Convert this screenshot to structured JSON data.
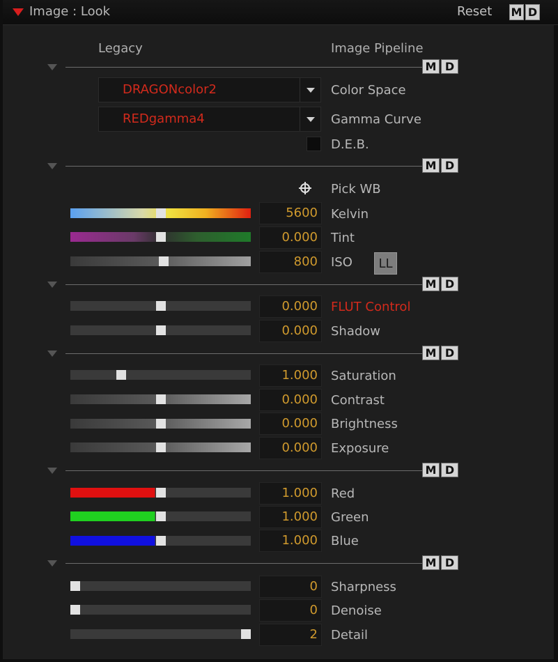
{
  "header": {
    "title": "Image : Look",
    "reset_label": "Reset",
    "m_label": "M",
    "d_label": "D"
  },
  "columns": {
    "left": "Legacy",
    "right": "Image Pipeline"
  },
  "dropdowns": [
    {
      "value": "DRAGONcolor2",
      "label": "Color Space"
    },
    {
      "value": "REDgamma4",
      "label": "Gamma Curve"
    }
  ],
  "deb": {
    "label": "D.E.B.",
    "checked": false
  },
  "pick_wb": {
    "label": "Pick WB",
    "icon": "crosshair-icon"
  },
  "ll_label": "LL",
  "sliders": {
    "kelvin": {
      "value": "5600",
      "label": "Kelvin",
      "position": 0.5
    },
    "tint": {
      "value": "0.000",
      "label": "Tint",
      "position": 0.5
    },
    "iso": {
      "value": "800",
      "label": "ISO",
      "position": 0.52
    },
    "flut": {
      "value": "0.000",
      "label": "FLUT Control",
      "position": 0.5
    },
    "shadow": {
      "value": "0.000",
      "label": "Shadow",
      "position": 0.5
    },
    "saturation": {
      "value": "1.000",
      "label": "Saturation",
      "position": 0.27
    },
    "contrast": {
      "value": "0.000",
      "label": "Contrast",
      "position": 0.5
    },
    "brightness": {
      "value": "0.000",
      "label": "Brightness",
      "position": 0.5
    },
    "exposure": {
      "value": "0.000",
      "label": "Exposure",
      "position": 0.5
    },
    "red": {
      "value": "1.000",
      "label": "Red",
      "position": 0.5
    },
    "green": {
      "value": "1.000",
      "label": "Green",
      "position": 0.5
    },
    "blue": {
      "value": "1.000",
      "label": "Blue",
      "position": 0.5
    },
    "sharpness": {
      "value": "0",
      "label": "Sharpness",
      "position": 0.0
    },
    "denoise": {
      "value": "0",
      "label": "Denoise",
      "position": 0.0
    },
    "detail": {
      "value": "2",
      "label": "Detail",
      "position": 1.0
    }
  },
  "colors": {
    "accent_red": "#d22a1c",
    "value_orange": "#d09a2d",
    "label_gray": "#b8b8b8"
  }
}
